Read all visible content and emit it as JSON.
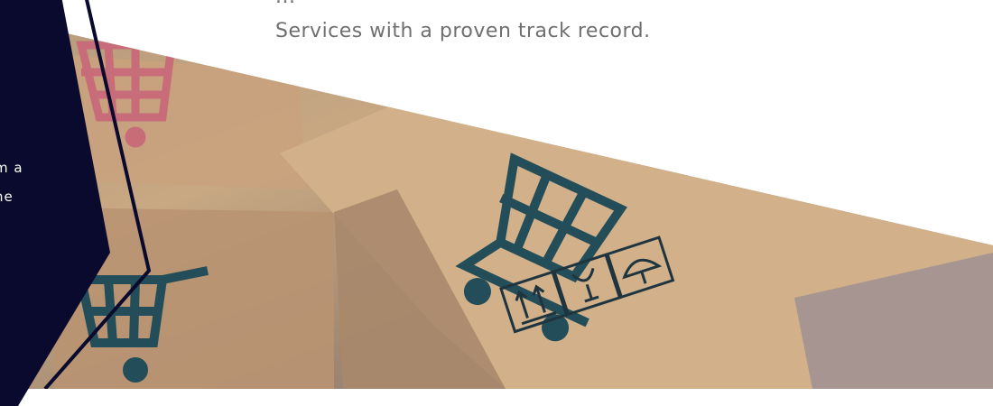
{
  "top_text": {
    "line1": "...",
    "line2": "Services with a proven track record."
  },
  "card_text": {
    "line1": "m a",
    "line2": "ne"
  },
  "icons": {
    "cart": "shopping-cart-icon",
    "up_arrows": "this-way-up-icon",
    "fragile": "fragile-glass-icon",
    "umbrella": "keep-dry-umbrella-icon"
  },
  "colors": {
    "dark_card": "#0a0a2e",
    "text_gray": "#6f6f6f",
    "cart_teal": "#234e59",
    "cart_pink": "#c86c7a",
    "cardboard": "#c8a883"
  }
}
